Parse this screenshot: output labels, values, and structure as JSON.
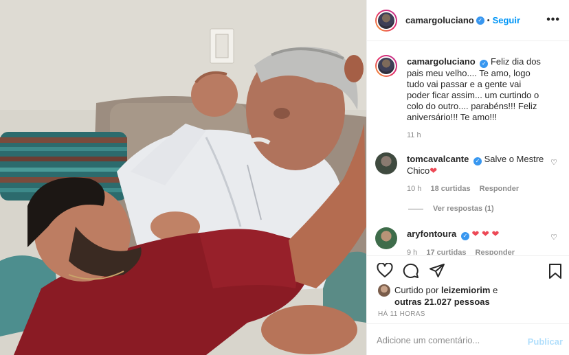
{
  "post": {
    "author": "camargoluciano",
    "follow_label": "Seguir",
    "dot": "•",
    "more": "•••",
    "verified_mark": "✓"
  },
  "caption": {
    "username": "camargoluciano",
    "text": "Feliz dia dos pais meu velho.... Te amo, logo tudo vai passar e a gente vai poder ficar assim... um curtindo o colo do outro.... parabéns!!! Feliz aniversário!!! Te amo!!!",
    "time": "11 h"
  },
  "comments": [
    {
      "username": "tomcavalcante",
      "text": "Salve o Mestre Chico",
      "heart": "❤",
      "time": "10 h",
      "likes": "18 curtidas",
      "reply": "Responder"
    },
    {
      "username": "aryfontoura",
      "text": "",
      "heart": "❤ ❤ ❤",
      "time": "9 h",
      "likes": "17 curtidas",
      "reply": "Responder"
    }
  ],
  "view_replies": "Ver respostas (1)",
  "likes": {
    "prefix": "Curtido por",
    "user": "leizemiorim",
    "connector": "e",
    "others": "outras 21.027 pessoas"
  },
  "timestamp": "HÁ 11 HORAS",
  "add_comment": {
    "placeholder": "Adicione um comentário...",
    "publish_label": "Publicar"
  },
  "icons": {
    "like": "heart-outline-icon",
    "comment": "comment-bubble-icon",
    "share": "paper-plane-icon",
    "save": "bookmark-icon"
  },
  "colors": {
    "accent": "#0095f6",
    "verified": "#3897f0",
    "heart": "#ed4956",
    "muted": "#8e8e8e"
  }
}
